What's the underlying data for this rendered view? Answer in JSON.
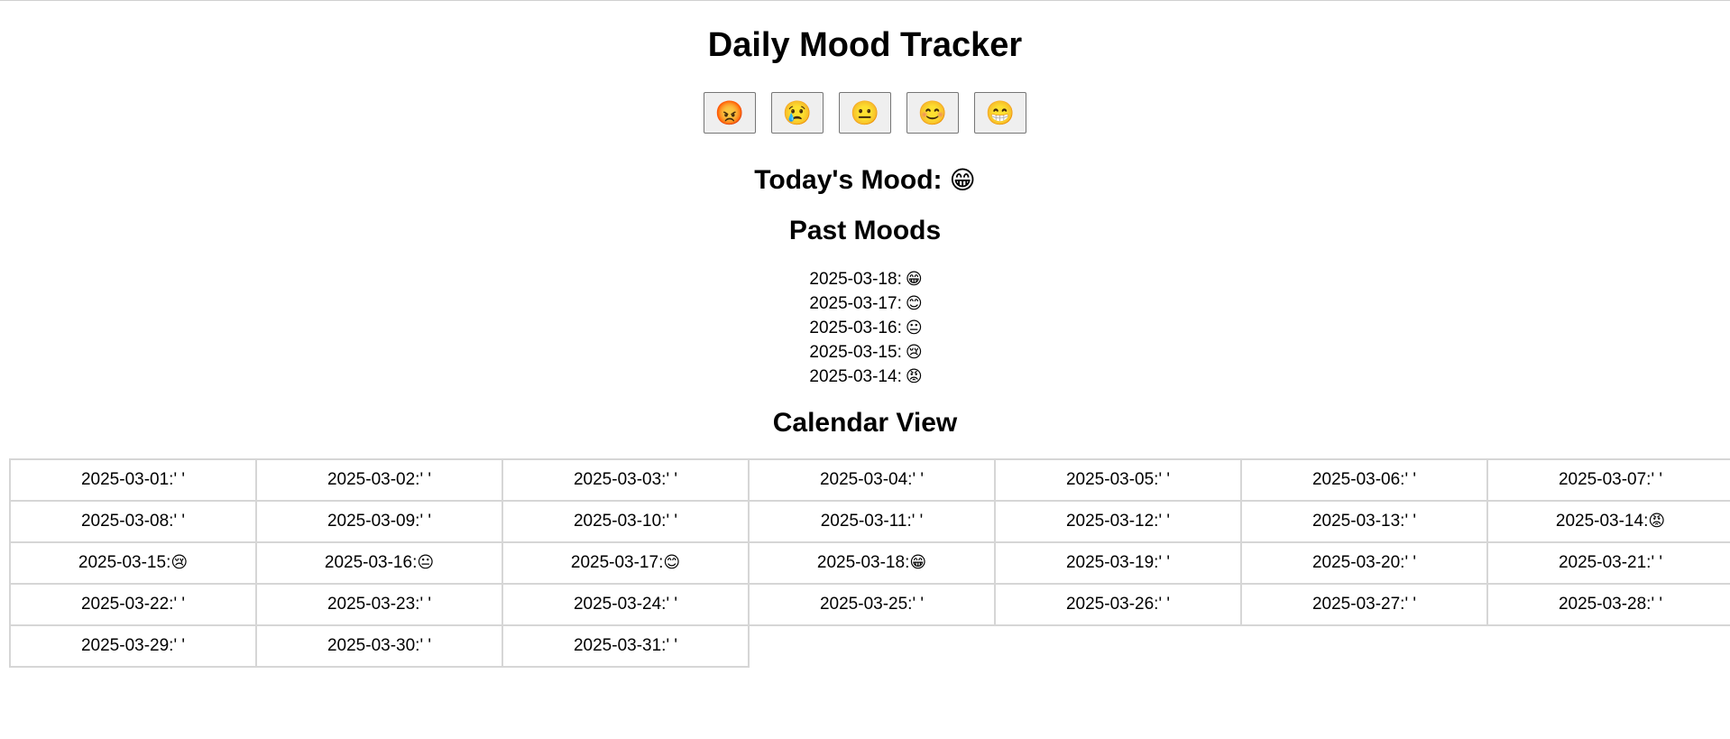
{
  "title": "Daily Mood Tracker",
  "mood_buttons": [
    {
      "emoji": "😡",
      "name": "angry"
    },
    {
      "emoji": "😢",
      "name": "sad"
    },
    {
      "emoji": "😐",
      "name": "neutral"
    },
    {
      "emoji": "😊",
      "name": "happy"
    },
    {
      "emoji": "😁",
      "name": "excited"
    }
  ],
  "today": {
    "label": "Today's Mood:",
    "emoji": "😁"
  },
  "past": {
    "title": "Past Moods",
    "entries": [
      {
        "date": "2025-03-18:",
        "emoji": "😁"
      },
      {
        "date": "2025-03-17:",
        "emoji": "😊"
      },
      {
        "date": "2025-03-16:",
        "emoji": "😐"
      },
      {
        "date": "2025-03-15:",
        "emoji": "😢"
      },
      {
        "date": "2025-03-14:",
        "emoji": "😡"
      }
    ]
  },
  "calendar": {
    "title": "Calendar View",
    "rows": [
      [
        {
          "date": "2025-03-01:",
          "mood": "' '"
        },
        {
          "date": "2025-03-02:",
          "mood": "' '"
        },
        {
          "date": "2025-03-03:",
          "mood": "' '"
        },
        {
          "date": "2025-03-04:",
          "mood": "' '"
        },
        {
          "date": "2025-03-05:",
          "mood": "' '"
        },
        {
          "date": "2025-03-06:",
          "mood": "' '"
        },
        {
          "date": "2025-03-07:",
          "mood": "' '"
        }
      ],
      [
        {
          "date": "2025-03-08:",
          "mood": "' '"
        },
        {
          "date": "2025-03-09:",
          "mood": "' '"
        },
        {
          "date": "2025-03-10:",
          "mood": "' '"
        },
        {
          "date": "2025-03-11:",
          "mood": "' '"
        },
        {
          "date": "2025-03-12:",
          "mood": "' '"
        },
        {
          "date": "2025-03-13:",
          "mood": "' '"
        },
        {
          "date": "2025-03-14:",
          "mood": "😡"
        }
      ],
      [
        {
          "date": "2025-03-15:",
          "mood": "😢"
        },
        {
          "date": "2025-03-16:",
          "mood": "😐"
        },
        {
          "date": "2025-03-17:",
          "mood": "😊"
        },
        {
          "date": "2025-03-18:",
          "mood": "😁"
        },
        {
          "date": "2025-03-19:",
          "mood": "' '"
        },
        {
          "date": "2025-03-20:",
          "mood": "' '"
        },
        {
          "date": "2025-03-21:",
          "mood": "' '"
        }
      ],
      [
        {
          "date": "2025-03-22:",
          "mood": "' '"
        },
        {
          "date": "2025-03-23:",
          "mood": "' '"
        },
        {
          "date": "2025-03-24:",
          "mood": "' '"
        },
        {
          "date": "2025-03-25:",
          "mood": "' '"
        },
        {
          "date": "2025-03-26:",
          "mood": "' '"
        },
        {
          "date": "2025-03-27:",
          "mood": "' '"
        },
        {
          "date": "2025-03-28:",
          "mood": "' '"
        }
      ],
      [
        {
          "date": "2025-03-29:",
          "mood": "' '"
        },
        {
          "date": "2025-03-30:",
          "mood": "' '"
        },
        {
          "date": "2025-03-31:",
          "mood": "' '"
        }
      ]
    ]
  }
}
